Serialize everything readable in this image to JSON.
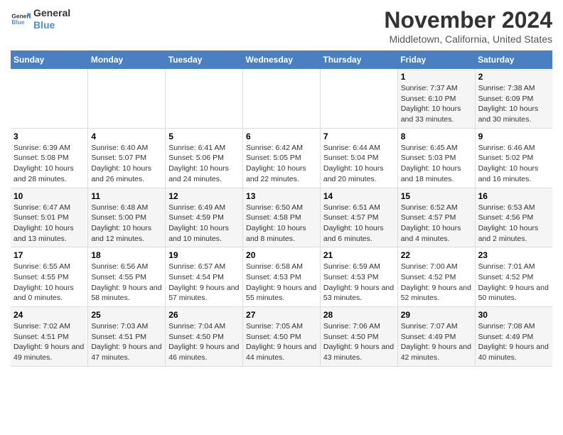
{
  "logo": {
    "general": "General",
    "blue": "Blue"
  },
  "header": {
    "month": "November 2024",
    "location": "Middletown, California, United States"
  },
  "weekdays": [
    "Sunday",
    "Monday",
    "Tuesday",
    "Wednesday",
    "Thursday",
    "Friday",
    "Saturday"
  ],
  "weeks": [
    [
      {
        "day": "",
        "info": ""
      },
      {
        "day": "",
        "info": ""
      },
      {
        "day": "",
        "info": ""
      },
      {
        "day": "",
        "info": ""
      },
      {
        "day": "",
        "info": ""
      },
      {
        "day": "1",
        "info": "Sunrise: 7:37 AM\nSunset: 6:10 PM\nDaylight: 10 hours and 33 minutes."
      },
      {
        "day": "2",
        "info": "Sunrise: 7:38 AM\nSunset: 6:09 PM\nDaylight: 10 hours and 30 minutes."
      }
    ],
    [
      {
        "day": "3",
        "info": "Sunrise: 6:39 AM\nSunset: 5:08 PM\nDaylight: 10 hours and 28 minutes."
      },
      {
        "day": "4",
        "info": "Sunrise: 6:40 AM\nSunset: 5:07 PM\nDaylight: 10 hours and 26 minutes."
      },
      {
        "day": "5",
        "info": "Sunrise: 6:41 AM\nSunset: 5:06 PM\nDaylight: 10 hours and 24 minutes."
      },
      {
        "day": "6",
        "info": "Sunrise: 6:42 AM\nSunset: 5:05 PM\nDaylight: 10 hours and 22 minutes."
      },
      {
        "day": "7",
        "info": "Sunrise: 6:44 AM\nSunset: 5:04 PM\nDaylight: 10 hours and 20 minutes."
      },
      {
        "day": "8",
        "info": "Sunrise: 6:45 AM\nSunset: 5:03 PM\nDaylight: 10 hours and 18 minutes."
      },
      {
        "day": "9",
        "info": "Sunrise: 6:46 AM\nSunset: 5:02 PM\nDaylight: 10 hours and 16 minutes."
      }
    ],
    [
      {
        "day": "10",
        "info": "Sunrise: 6:47 AM\nSunset: 5:01 PM\nDaylight: 10 hours and 13 minutes."
      },
      {
        "day": "11",
        "info": "Sunrise: 6:48 AM\nSunset: 5:00 PM\nDaylight: 10 hours and 12 minutes."
      },
      {
        "day": "12",
        "info": "Sunrise: 6:49 AM\nSunset: 4:59 PM\nDaylight: 10 hours and 10 minutes."
      },
      {
        "day": "13",
        "info": "Sunrise: 6:50 AM\nSunset: 4:58 PM\nDaylight: 10 hours and 8 minutes."
      },
      {
        "day": "14",
        "info": "Sunrise: 6:51 AM\nSunset: 4:57 PM\nDaylight: 10 hours and 6 minutes."
      },
      {
        "day": "15",
        "info": "Sunrise: 6:52 AM\nSunset: 4:57 PM\nDaylight: 10 hours and 4 minutes."
      },
      {
        "day": "16",
        "info": "Sunrise: 6:53 AM\nSunset: 4:56 PM\nDaylight: 10 hours and 2 minutes."
      }
    ],
    [
      {
        "day": "17",
        "info": "Sunrise: 6:55 AM\nSunset: 4:55 PM\nDaylight: 10 hours and 0 minutes."
      },
      {
        "day": "18",
        "info": "Sunrise: 6:56 AM\nSunset: 4:55 PM\nDaylight: 9 hours and 58 minutes."
      },
      {
        "day": "19",
        "info": "Sunrise: 6:57 AM\nSunset: 4:54 PM\nDaylight: 9 hours and 57 minutes."
      },
      {
        "day": "20",
        "info": "Sunrise: 6:58 AM\nSunset: 4:53 PM\nDaylight: 9 hours and 55 minutes."
      },
      {
        "day": "21",
        "info": "Sunrise: 6:59 AM\nSunset: 4:53 PM\nDaylight: 9 hours and 53 minutes."
      },
      {
        "day": "22",
        "info": "Sunrise: 7:00 AM\nSunset: 4:52 PM\nDaylight: 9 hours and 52 minutes."
      },
      {
        "day": "23",
        "info": "Sunrise: 7:01 AM\nSunset: 4:52 PM\nDaylight: 9 hours and 50 minutes."
      }
    ],
    [
      {
        "day": "24",
        "info": "Sunrise: 7:02 AM\nSunset: 4:51 PM\nDaylight: 9 hours and 49 minutes."
      },
      {
        "day": "25",
        "info": "Sunrise: 7:03 AM\nSunset: 4:51 PM\nDaylight: 9 hours and 47 minutes."
      },
      {
        "day": "26",
        "info": "Sunrise: 7:04 AM\nSunset: 4:50 PM\nDaylight: 9 hours and 46 minutes."
      },
      {
        "day": "27",
        "info": "Sunrise: 7:05 AM\nSunset: 4:50 PM\nDaylight: 9 hours and 44 minutes."
      },
      {
        "day": "28",
        "info": "Sunrise: 7:06 AM\nSunset: 4:50 PM\nDaylight: 9 hours and 43 minutes."
      },
      {
        "day": "29",
        "info": "Sunrise: 7:07 AM\nSunset: 4:49 PM\nDaylight: 9 hours and 42 minutes."
      },
      {
        "day": "30",
        "info": "Sunrise: 7:08 AM\nSunset: 4:49 PM\nDaylight: 9 hours and 40 minutes."
      }
    ]
  ]
}
